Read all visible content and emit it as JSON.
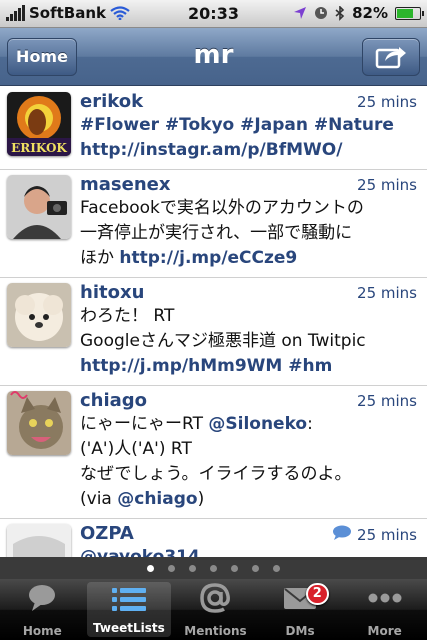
{
  "status_bar": {
    "carrier": "SoftBank",
    "time": "20:33",
    "battery": "82%",
    "battery_level": 0.82
  },
  "nav": {
    "title": "mr",
    "home_label": "Home",
    "compose_icon": "compose-icon"
  },
  "tweets": [
    {
      "user": "erikok",
      "time": "25 mins",
      "avatar_text": "ERIKOK",
      "lines": [
        [
          [
            "#Flower #Tokyo #Japan #Nature",
            true
          ]
        ],
        [
          [
            "http://instagr.am/p/BfMWO/",
            true
          ]
        ]
      ]
    },
    {
      "user": "masenex",
      "time": "25 mins",
      "lines": [
        [
          [
            "Facebookで実名以外のアカウントの",
            false
          ]
        ],
        [
          [
            "一斉停止が実行され、一部で騒動に",
            false
          ]
        ],
        [
          [
            "ほか ",
            false
          ],
          [
            "http://j.mp/eCCze9",
            true
          ]
        ]
      ]
    },
    {
      "user": "hitoxu",
      "time": "25 mins",
      "lines": [
        [
          [
            "わろた！ RT",
            false
          ]
        ],
        [
          [
            "Googleさんマジ極悪非道 on Twitpic",
            false
          ]
        ],
        [
          [
            "http://j.mp/hMm9WM #hm",
            true
          ]
        ]
      ]
    },
    {
      "user": "chiago",
      "time": "25 mins",
      "lines": [
        [
          [
            "にゃーにゃーRT ",
            false
          ],
          [
            "@Siloneko",
            true
          ],
          [
            ":",
            false
          ]
        ],
        [
          [
            "('A')人('A') RT",
            false
          ]
        ],
        [
          [
            "なぜでしょう。イライラするのよ。",
            false
          ]
        ],
        [
          [
            "(via ",
            false
          ],
          [
            "@chiago",
            true
          ],
          [
            ")",
            false
          ]
        ]
      ]
    },
    {
      "user": "OZPA",
      "time": "25 mins",
      "has_reply_icon": true,
      "lines": [
        [
          [
            "@yayoko314",
            true
          ]
        ]
      ]
    }
  ],
  "pagination": {
    "pages": 7,
    "active": 0
  },
  "tabs": [
    {
      "label": "Home",
      "icon": "speech-bubble-icon"
    },
    {
      "label": "TweetLists",
      "icon": "list-icon",
      "active": true
    },
    {
      "label": "Mentions",
      "icon": "at-sign-icon"
    },
    {
      "label": "DMs",
      "icon": "envelope-icon",
      "badge": "2"
    },
    {
      "label": "More",
      "icon": "more-dots-icon"
    }
  ],
  "colors": {
    "link": "#29467c",
    "nav": "#5e7aa0",
    "badge": "#d8202a"
  }
}
